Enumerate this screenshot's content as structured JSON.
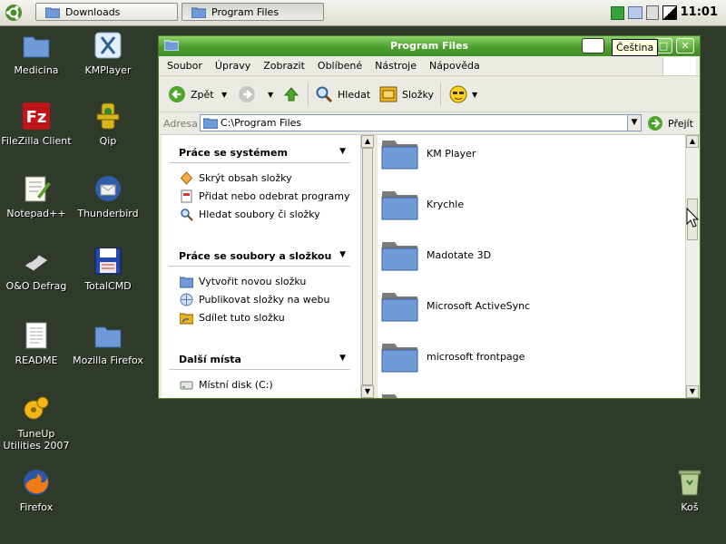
{
  "taskbar": {
    "tasks": [
      {
        "label": "Downloads"
      },
      {
        "label": "Program Files"
      }
    ],
    "tray_icons": [
      "green-status-icon",
      "printer-icon",
      "network-icon",
      "volume-icon"
    ],
    "clock": "11:01"
  },
  "desktop": {
    "icons": [
      {
        "label": "Medicina",
        "icon": "folder-icon"
      },
      {
        "label": "KMPlayer",
        "icon": "kmplayer-icon"
      },
      {
        "label": "FileZilla Client",
        "icon": "filezilla-icon"
      },
      {
        "label": "Qip",
        "icon": "qip-icon"
      },
      {
        "label": "Notepad++",
        "icon": "notepad-icon"
      },
      {
        "label": "Thunderbird",
        "icon": "thunderbird-icon"
      },
      {
        "label": "O&O Defrag",
        "icon": "defrag-icon"
      },
      {
        "label": "TotalCMD",
        "icon": "floppy-icon"
      },
      {
        "label": "README",
        "icon": "text-file-icon"
      },
      {
        "label": "Mozilla Firefox",
        "icon": "folder-icon"
      },
      {
        "label": "TuneUp Utilities 2007",
        "icon": "tuneup-icon"
      },
      {
        "label": "Firefox",
        "icon": "firefox-icon"
      },
      {
        "label": "Koš",
        "icon": "recycle-bin-icon"
      }
    ]
  },
  "window": {
    "title": "Program Files",
    "menu": [
      "Soubor",
      "Úpravy",
      "Zobrazit",
      "Oblíbené",
      "Nástroje",
      "Nápověda"
    ],
    "toolbar": {
      "back_label": "Zpět",
      "search_label": "Hledat",
      "folders_label": "Složky"
    },
    "address": {
      "label": "Adresa",
      "value": "C:\\Program Files",
      "go_label": "Přejít"
    },
    "task_pane": {
      "groups": [
        {
          "title": "Práce se systémem",
          "items": [
            {
              "label": "Skrýt obsah složky",
              "icon": "hide-icon"
            },
            {
              "label": "Přidat nebo odebrat programy",
              "icon": "add-remove-icon"
            },
            {
              "label": "Hledat soubory či složky",
              "icon": "search-icon"
            }
          ]
        },
        {
          "title": "Práce se soubory a složkou",
          "items": [
            {
              "label": "Vytvořit novou složku",
              "icon": "new-folder-icon"
            },
            {
              "label": "Publikovat složky na webu",
              "icon": "publish-web-icon"
            },
            {
              "label": "Sdílet tuto složku",
              "icon": "share-icon"
            }
          ]
        },
        {
          "title": "Další místa",
          "items": [
            {
              "label": "Místní disk (C:)",
              "icon": "disk-icon"
            }
          ]
        }
      ]
    },
    "files": [
      {
        "label": "KM Player"
      },
      {
        "label": "Krychle"
      },
      {
        "label": "Madotate 3D"
      },
      {
        "label": "Microsoft ActiveSync"
      },
      {
        "label": "microsoft frontpage"
      }
    ]
  },
  "tooltip": "Čeština",
  "colors": {
    "desktop": "#2f3a2b",
    "titlebar": "#4c9f2c",
    "folder": "#6f9bd8"
  }
}
